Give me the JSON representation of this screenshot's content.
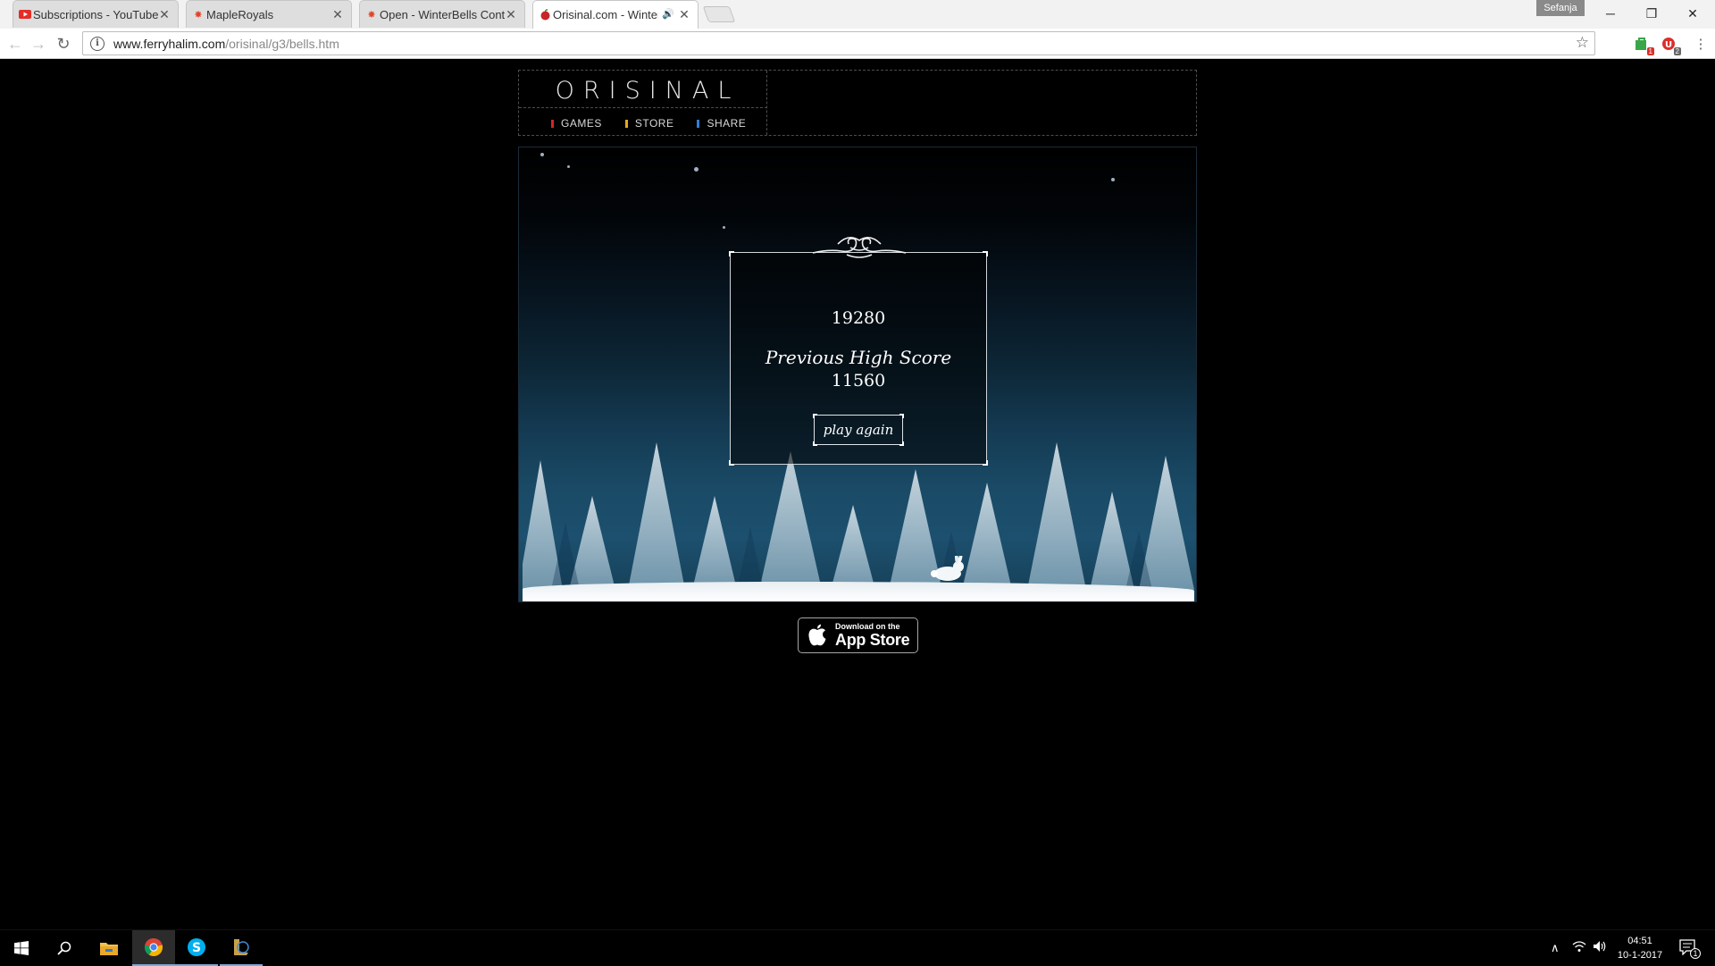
{
  "browser": {
    "tabs": [
      {
        "title": "Subscriptions - YouTube",
        "favicon": "youtube-icon"
      },
      {
        "title": "MapleRoyals",
        "favicon": "maple-leaf-icon"
      },
      {
        "title": "Open - WinterBells Cont",
        "favicon": "maple-leaf-icon"
      },
      {
        "title": "Orisinal.com - Winter",
        "favicon": "orisinal-apple-icon",
        "active": true
      }
    ],
    "profile_name": "Sefanja",
    "url_host": "www.ferryhalim.com",
    "url_path": "/orisinal/g3/bells.htm",
    "extension_badges": [
      "1",
      "2"
    ]
  },
  "site": {
    "logo": "ORISINAL",
    "nav": [
      {
        "label": "GAMES",
        "color": "#d0262c"
      },
      {
        "label": "STORE",
        "color": "#e8a81e"
      },
      {
        "label": "SHARE",
        "color": "#2f7fd1"
      }
    ]
  },
  "game": {
    "score": "19280",
    "high_score_label": "Previous High Score",
    "high_score": "11560",
    "play_again_label": "play again"
  },
  "appstore": {
    "small_text": "Download on the",
    "big_text": "App Store"
  },
  "taskbar": {
    "apps": [
      "windows-start-icon",
      "search-icon",
      "file-explorer-icon",
      "chrome-icon",
      "skype-icon",
      "league-of-legends-icon"
    ],
    "time": "04:51",
    "date": "10-1-2017",
    "notification_count": "1"
  }
}
